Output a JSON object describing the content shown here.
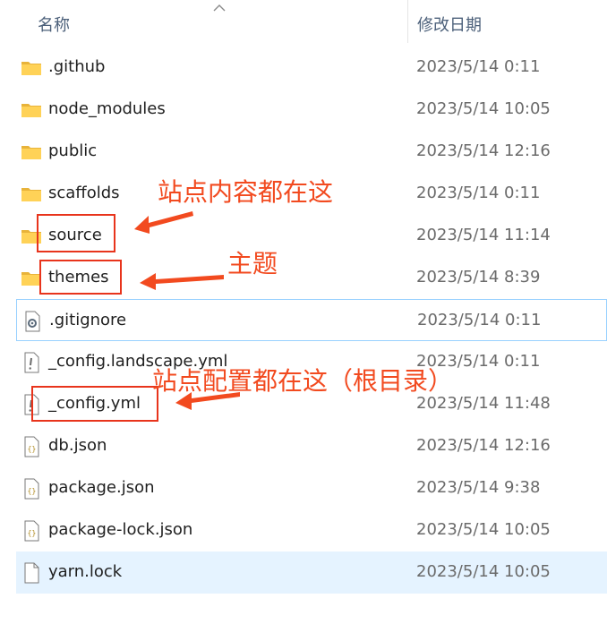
{
  "header": {
    "name_label": "名称",
    "date_label": "修改日期"
  },
  "files": [
    {
      "name": ".github",
      "date": "2023/5/14 0:11",
      "icon": "folder-icon"
    },
    {
      "name": "node_modules",
      "date": "2023/5/14 10:05",
      "icon": "folder-icon"
    },
    {
      "name": "public",
      "date": "2023/5/14 12:16",
      "icon": "folder-icon"
    },
    {
      "name": "scaffolds",
      "date": "2023/5/14 0:11",
      "icon": "folder-icon"
    },
    {
      "name": "source",
      "date": "2023/5/14 11:14",
      "icon": "folder-icon"
    },
    {
      "name": "themes",
      "date": "2023/5/14 8:39",
      "icon": "folder-icon"
    },
    {
      "name": ".gitignore",
      "date": "2023/5/14 0:11",
      "icon": "settings-file-icon"
    },
    {
      "name": "_config.landscape.yml",
      "date": "2023/5/14 0:11",
      "icon": "yml-file-icon"
    },
    {
      "name": "_config.yml",
      "date": "2023/5/14 11:48",
      "icon": "yml-file-icon"
    },
    {
      "name": "db.json",
      "date": "2023/5/14 12:16",
      "icon": "json-file-icon"
    },
    {
      "name": "package.json",
      "date": "2023/5/14 9:38",
      "icon": "json-file-icon"
    },
    {
      "name": "package-lock.json",
      "date": "2023/5/14 10:05",
      "icon": "json-file-icon"
    },
    {
      "name": "yarn.lock",
      "date": "2023/5/14 10:05",
      "icon": "blank-file-icon"
    }
  ],
  "annotations": {
    "source_note": "站点内容都在这",
    "themes_note": "主题",
    "config_note": "站点配置都在这（根目录）"
  },
  "colors": {
    "annotation": "#f24a1f",
    "selection": "#e5f3ff",
    "focus_outline": "#99d1ff",
    "folder": "#ffd257"
  }
}
